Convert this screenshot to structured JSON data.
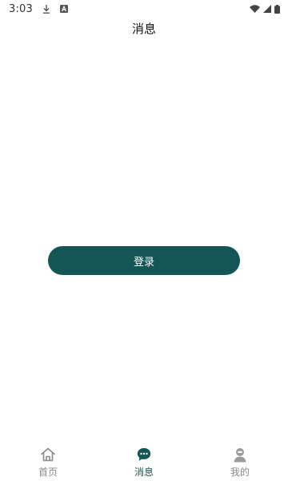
{
  "status_bar": {
    "time": "3:03",
    "icons": [
      "download-icon",
      "a-icon",
      "wifi-icon",
      "signal-icon",
      "battery-icon"
    ]
  },
  "header": {
    "title": "消息"
  },
  "main": {
    "login_label": "登录"
  },
  "bottom_nav": {
    "items": [
      {
        "label": "首页",
        "icon": "home-icon",
        "active": false
      },
      {
        "label": "消息",
        "icon": "chat-bubble-icon",
        "active": true
      },
      {
        "label": "我的",
        "icon": "user-icon",
        "active": false
      }
    ]
  },
  "colors": {
    "accent": "#145656",
    "inactive": "#8a8a8a"
  }
}
